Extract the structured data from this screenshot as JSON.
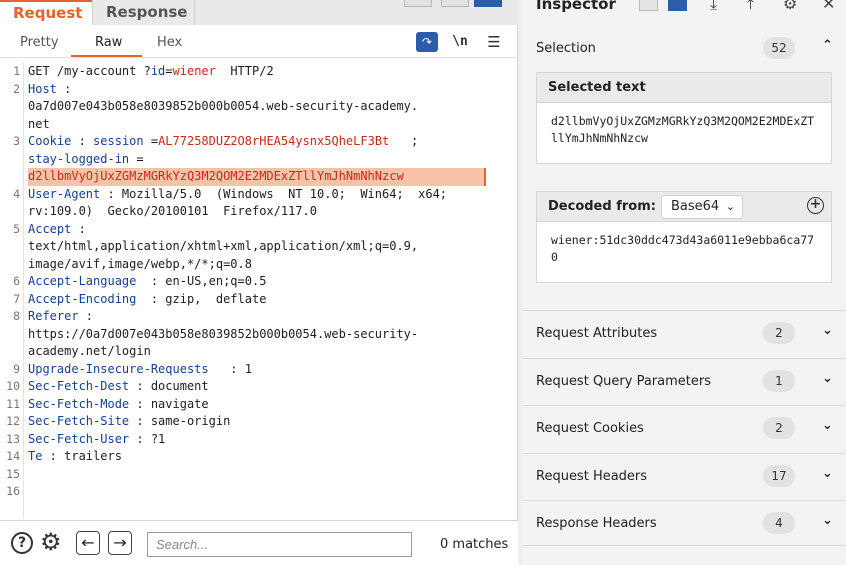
{
  "tabs": {
    "request": "Request",
    "response": "Response"
  },
  "subtabs": {
    "pretty": "Pretty",
    "raw": "Raw",
    "hex": "Hex"
  },
  "subtab_buttons": {
    "newline": "\\n"
  },
  "request_lines": [
    {
      "n": "1",
      "segs": [
        [
          "p",
          "GET /my-account ?"
        ],
        [
          "k",
          "id"
        ],
        [
          "p",
          "="
        ],
        [
          "v",
          "wiener"
        ],
        [
          "p",
          "  HTTP/2"
        ]
      ]
    },
    {
      "n": "2",
      "segs": [
        [
          "k",
          "Host"
        ],
        [
          "p",
          " :"
        ]
      ]
    },
    {
      "n": "",
      "segs": [
        [
          "p",
          "0a7d007e043b058e8039852b000b0054.web-security-academy."
        ]
      ]
    },
    {
      "n": "",
      "segs": [
        [
          "p",
          "net"
        ]
      ]
    },
    {
      "n": "3",
      "segs": [
        [
          "k",
          "Cookie"
        ],
        [
          "p",
          " : "
        ],
        [
          "k",
          "session"
        ],
        [
          "p",
          " ="
        ],
        [
          "v",
          "AL77258DUZ2O8rHEA54ysnx5QheLF3Bt"
        ],
        [
          "p",
          "   ;"
        ]
      ]
    },
    {
      "n": "",
      "segs": [
        [
          "k",
          "stay-logged-in"
        ],
        [
          "p",
          " ="
        ]
      ]
    },
    {
      "n": "",
      "hl": true,
      "segs": [
        [
          "v",
          "d2llbmVyOjUxZGMzMGRkYzQ3M2QOM2E2MDExZTllYmJhNmNhNzcw"
        ]
      ]
    },
    {
      "n": "4",
      "segs": [
        [
          "k",
          "User-Agent"
        ],
        [
          "p",
          " : Mozilla/5.0  (Windows  NT 10.0;  Win64;  x64;"
        ]
      ]
    },
    {
      "n": "",
      "segs": [
        [
          "p",
          "rv:109.0)  Gecko/20100101  Firefox/117.0"
        ]
      ]
    },
    {
      "n": "5",
      "segs": [
        [
          "k",
          "Accept"
        ],
        [
          "p",
          " :"
        ]
      ]
    },
    {
      "n": "",
      "segs": [
        [
          "p",
          "text/html,application/xhtml+xml,application/xml;q=0.9,"
        ]
      ]
    },
    {
      "n": "",
      "segs": [
        [
          "p",
          "image/avif,image/webp,*/*;q=0.8"
        ]
      ]
    },
    {
      "n": "6",
      "segs": [
        [
          "k",
          "Accept-Language"
        ],
        [
          "p",
          "  : en-US,en;q=0.5"
        ]
      ]
    },
    {
      "n": "7",
      "segs": [
        [
          "k",
          "Accept-Encoding"
        ],
        [
          "p",
          "  : gzip,  deflate"
        ]
      ]
    },
    {
      "n": "8",
      "segs": [
        [
          "k",
          "Referer"
        ],
        [
          "p",
          " :"
        ]
      ]
    },
    {
      "n": "",
      "segs": [
        [
          "p",
          "https://0a7d007e043b058e8039852b000b0054.web-security-"
        ]
      ]
    },
    {
      "n": "",
      "segs": [
        [
          "p",
          "academy.net/login"
        ]
      ]
    },
    {
      "n": "9",
      "segs": [
        [
          "k",
          "Upgrade-Insecure-Requests"
        ],
        [
          "p",
          "   : 1"
        ]
      ]
    },
    {
      "n": "10",
      "segs": [
        [
          "k",
          "Sec-Fetch-Dest"
        ],
        [
          "p",
          " : document"
        ]
      ]
    },
    {
      "n": "11",
      "segs": [
        [
          "k",
          "Sec-Fetch-Mode"
        ],
        [
          "p",
          " : navigate"
        ]
      ]
    },
    {
      "n": "12",
      "segs": [
        [
          "k",
          "Sec-Fetch-Site"
        ],
        [
          "p",
          " : same-origin"
        ]
      ]
    },
    {
      "n": "13",
      "segs": [
        [
          "k",
          "Sec-Fetch-User"
        ],
        [
          "p",
          " : ?1"
        ]
      ]
    },
    {
      "n": "14",
      "segs": [
        [
          "k",
          "Te"
        ],
        [
          "p",
          " : trailers"
        ]
      ]
    },
    {
      "n": "15",
      "segs": []
    },
    {
      "n": "16",
      "segs": []
    }
  ],
  "bottom": {
    "help": "?",
    "search_placeholder": "Search...",
    "matches": "0 matches"
  },
  "inspector": {
    "title": "Inspector",
    "selection_label": "Selection",
    "selection_count": "52",
    "selected_text_label": "Selected text",
    "selected_text": "d2llbmVyOjUxZGMzMGRkYzQ3M2QOM2E2MDExZTllYmJhNmNhNzcw",
    "decoded_from_label": "Decoded from:",
    "decoded_format": "Base64",
    "decoded_text": "wiener:51dc30ddc473d43a6011e9ebba6ca770",
    "sections": [
      {
        "label": "Request Attributes",
        "count": "2"
      },
      {
        "label": "Request Query Parameters",
        "count": "1"
      },
      {
        "label": "Request Cookies",
        "count": "2"
      },
      {
        "label": "Request Headers",
        "count": "17"
      },
      {
        "label": "Response Headers",
        "count": "4"
      }
    ]
  },
  "colors": {
    "accent": "#e8622a",
    "header_key": "#17408c",
    "value_red": "#c42b1f",
    "highlight": "#f7c2a8",
    "toggle_blue": "#2c5dac"
  }
}
